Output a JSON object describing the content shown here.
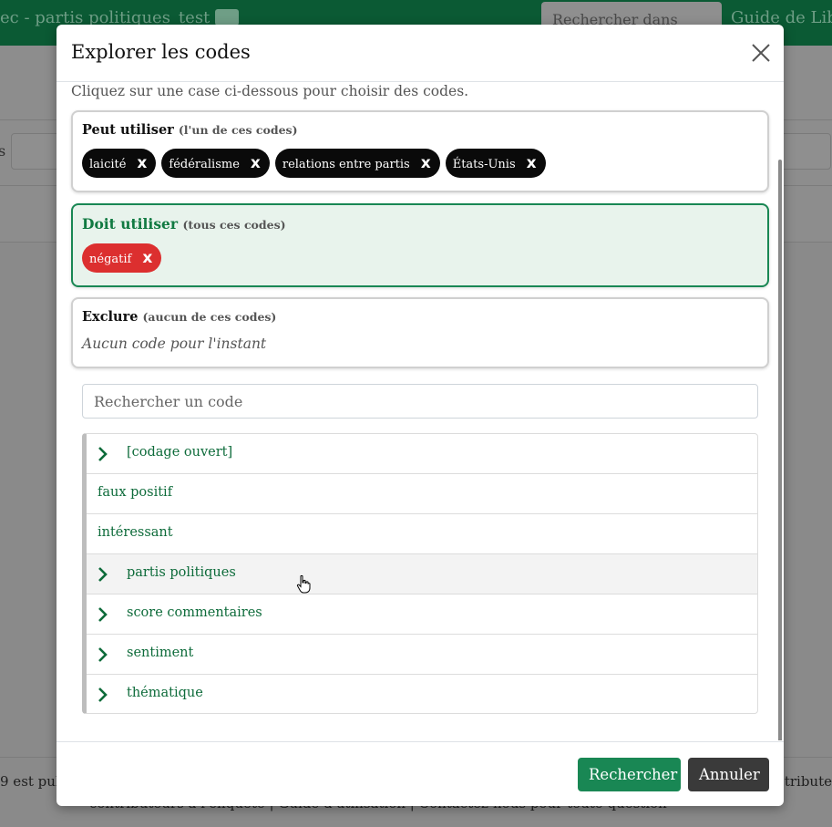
{
  "background": {
    "app_title": "ec - partis politiques_test",
    "search_placeholder": "Rechercher dans",
    "guide_link": "Guide de Libr",
    "footer_left": "9 est pub",
    "footer_right": "tribute",
    "footer_line": "contributeurs à l'enquête | Guide d'utilisation | Contactez-nous pour toute question",
    "left_fragment": "s"
  },
  "modal": {
    "title": "Explorer les codes",
    "intro": "Cliquez sur une case ci-dessous pour choisir des codes.",
    "can_use": {
      "heading": "Peut utiliser",
      "subheading": "(l'un de ces codes)",
      "chips": [
        "laicité",
        "fédéralisme",
        "relations entre partis",
        "États-Unis"
      ],
      "remove_glyph": "x"
    },
    "must_use": {
      "heading": "Doit utiliser",
      "subheading": "(tous ces codes)",
      "chips": [
        "négatif"
      ],
      "remove_glyph": "x"
    },
    "exclude": {
      "heading": "Exclure",
      "subheading": "(aucun de ces codes)",
      "empty_text": "Aucun code pour l'instant"
    },
    "search": {
      "placeholder": "Rechercher un code",
      "value": ""
    },
    "code_tree": [
      {
        "label": "[codage ouvert]",
        "expandable": true
      },
      {
        "label": "faux positif",
        "expandable": false
      },
      {
        "label": "intéressant",
        "expandable": false
      },
      {
        "label": "partis politiques",
        "expandable": true,
        "hovered": true
      },
      {
        "label": "score commentaires",
        "expandable": true
      },
      {
        "label": "sentiment",
        "expandable": true
      },
      {
        "label": "thématique",
        "expandable": true
      }
    ],
    "footer": {
      "search_button": "Rechercher",
      "cancel_button": "Annuler"
    }
  },
  "colors": {
    "primary_green": "#198754",
    "must_box_bg": "#e8f3ec",
    "chip_black": "#0a0a0a",
    "chip_red": "#dc2f2f",
    "link_green": "#0d6b3a",
    "cancel_dark": "#3a3a3a"
  },
  "icons": {
    "close": "close-icon",
    "chevron": "chevron-right-icon",
    "briefcase": "briefcase-icon",
    "search": "search-icon"
  }
}
